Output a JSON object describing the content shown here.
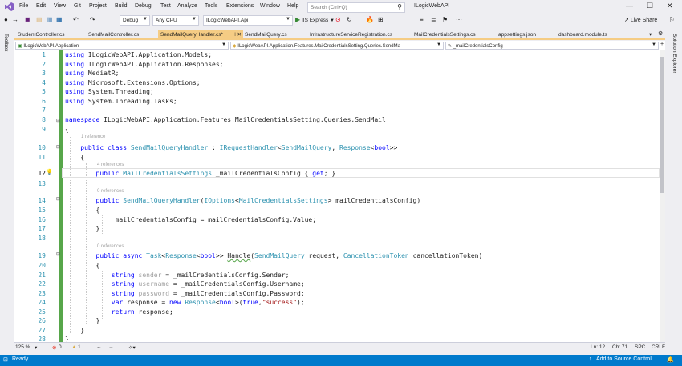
{
  "window": {
    "solution_name": "ILogicWebAPI",
    "search_placeholder": "Search (Ctrl+Q)",
    "live_share_label": "Live Share"
  },
  "menu": [
    "File",
    "Edit",
    "View",
    "Git",
    "Project",
    "Build",
    "Debug",
    "Test",
    "Analyze",
    "Tools",
    "Extensions",
    "Window",
    "Help"
  ],
  "toolbar": {
    "config": "Debug",
    "platform": "Any CPU",
    "startup_project": "ILogicWebAPI.Api",
    "run_target": "IIS Express"
  },
  "tabs": [
    {
      "label": "StudentController.cs",
      "active": false
    },
    {
      "label": "SendMailController.cs",
      "active": false
    },
    {
      "label": "SendMailQueryHandler.cs*",
      "active": true
    },
    {
      "label": "SendMailQuery.cs",
      "active": false
    },
    {
      "label": "InfrastructureServiceRegistration.cs",
      "active": false
    },
    {
      "label": "MailCredentialsSettings.cs",
      "active": false
    },
    {
      "label": "appsettings.json",
      "active": false
    },
    {
      "label": "dashboard.module.ts",
      "active": false
    }
  ],
  "navbar": {
    "project": "ILogicWebAPI.Application",
    "type": "ILogicWebAPI.Application.Features.MailCredentialsSetting.Queries.SendMa",
    "member": "_mailCredentialsConfig"
  },
  "side_panels": {
    "left": "Toolbox",
    "right": "Solution Explorer"
  },
  "code": {
    "lines": [
      {
        "n": "1",
        "text": "using ILogicWebAPI.Application.Models;"
      },
      {
        "n": "2",
        "text": "using ILogicWebAPI.Application.Responses;"
      },
      {
        "n": "3",
        "text": "using MediatR;"
      },
      {
        "n": "4",
        "text": "using Microsoft.Extensions.Options;"
      },
      {
        "n": "5",
        "text": "using System.Threading;"
      },
      {
        "n": "6",
        "text": "using System.Threading.Tasks;"
      },
      {
        "n": "7",
        "text": ""
      },
      {
        "n": "8",
        "text": "namespace ILogicWebAPI.Application.Features.MailCredentialsSetting.Queries.SendMail"
      },
      {
        "n": "9",
        "text": "{"
      },
      {
        "n": "10",
        "text": "public class SendMailQueryHandler : IRequestHandler<SendMailQuery, Response<bool>>"
      },
      {
        "n": "11",
        "text": "{"
      },
      {
        "n": "12",
        "text": "public MailCredentialsSettings _mailCredentialsConfig { get; }"
      },
      {
        "n": "13",
        "text": ""
      },
      {
        "n": "14",
        "text": "public SendMailQueryHandler(IOptions<MailCredentialsSettings> mailCredentialsConfig)"
      },
      {
        "n": "15",
        "text": "{"
      },
      {
        "n": "16",
        "text": "_mailCredentialsConfig = mailCredentialsConfig.Value;"
      },
      {
        "n": "17",
        "text": "}"
      },
      {
        "n": "18",
        "text": ""
      },
      {
        "n": "19",
        "text": "public async Task<Response<bool>> Handle(SendMailQuery request, CancellationToken cancellationToken)"
      },
      {
        "n": "20",
        "text": "{"
      },
      {
        "n": "21",
        "text": "string sender = _mailCredentialsConfig.Sender;"
      },
      {
        "n": "22",
        "text": "string username = _mailCredentialsConfig.Username;"
      },
      {
        "n": "23",
        "text": "string password = _mailCredentialsConfig.Password;"
      },
      {
        "n": "24",
        "text": "var response = new Response<bool>(true,\"success\");"
      },
      {
        "n": "25",
        "text": "return response;"
      },
      {
        "n": "26",
        "text": "}"
      },
      {
        "n": "27",
        "text": "}"
      },
      {
        "n": "28",
        "text": "}"
      }
    ],
    "refs": {
      "class": "1 reference",
      "property": "4 references",
      "ctor": "0 references",
      "handle": "0 references"
    }
  },
  "editor_status": {
    "zoom": "125 %",
    "errors": "0",
    "warnings": "1",
    "line": "Ln: 12",
    "col": "Ch: 71",
    "spacing": "SPC",
    "line_ending": "CRLF"
  },
  "statusbar": {
    "state": "Ready",
    "source_control": "Add to Source Control"
  },
  "colors": {
    "accent": "#007acc",
    "active_tab": "#f5cc84",
    "keyword": "#0000ff",
    "type": "#2b91af",
    "string": "#a31515",
    "change_mark": "#57a64a"
  }
}
